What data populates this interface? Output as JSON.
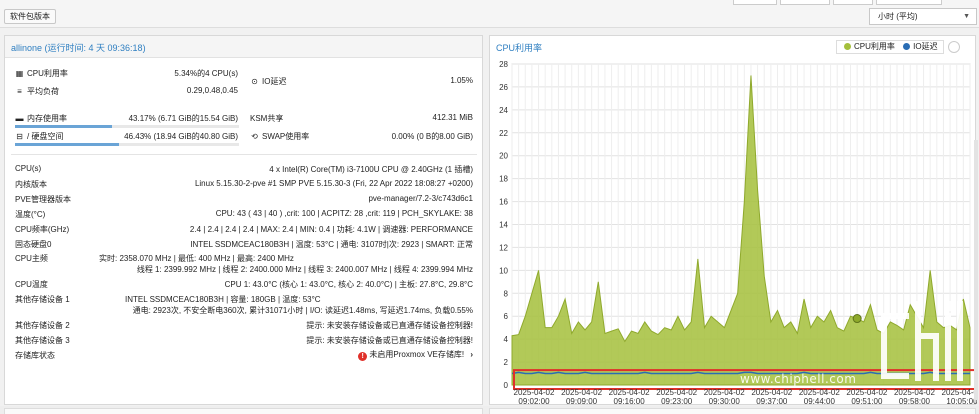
{
  "toolbar": {
    "package_button": "软件包版本",
    "timeframe": "小时 (平均)"
  },
  "node": {
    "title": "allinone (运行时间: 4 天 09:36:18)",
    "summary": {
      "cpu_label": "CPU利用率",
      "cpu_value": "5.34%的4 CPU(s)",
      "io_label": "IO延迟",
      "io_value": "1.05%",
      "load_label": "平均负荷",
      "load_value": "0.29,0.48,0.45",
      "mem_label": "内存使用率",
      "mem_value": "43.17% (6.71 GiB的15.54 GiB)",
      "mem_fraction": 0.4317,
      "ksm_label": "KSM共享",
      "ksm_value": "412.31 MiB",
      "disk_label": "/ 硬盘空间",
      "disk_value": "46.43% (18.94 GiB的40.80 GiB)",
      "disk_fraction": 0.4643,
      "swap_label": "SWAP使用率",
      "swap_value": "0.00% (0 B的8.00 GiB)"
    },
    "details": [
      {
        "label": "CPU(s)",
        "value": "4 x Intel(R) Core(TM) i3-7100U CPU @ 2.40GHz (1 插槽)"
      },
      {
        "label": "内核版本",
        "value": "Linux 5.15.30-2-pve #1 SMP PVE 5.15.30-3 (Fri, 22 Apr 2022 18:08:27 +0200)"
      },
      {
        "label": "PVE管理器版本",
        "value": "pve-manager/7.2-3/c743d6c1"
      },
      {
        "label": "温度(°C)",
        "value": "CPU: 43 ( 43 | 40 ) ,crit: 100 | ACPITZ: 28 ,crit: 119 | PCH_SKYLAKE: 38"
      },
      {
        "label": "CPU频率(GHz)",
        "value": "2.4 | 2.4 | 2.4 | 2.4 | MAX: 2.4 | MIN: 0.4 | 功耗: 4.1W | 调速器: PERFORMANCE"
      },
      {
        "label": "固态硬盘0",
        "value": "INTEL SSDMCEAC180B3H | 温度: 53°C | 通电: 3107时|次: 2923 | SMART: 正常"
      }
    ],
    "cpu_freq": {
      "label": "CPU主频",
      "line1": "实时: 2358.070 MHz | 最低: 400 MHz | 最高: 2400 MHz",
      "line2": "线程 1: 2399.992 MHz | 线程 2: 2400.000 MHz | 线程 3: 2400.007 MHz | 线程 4: 2399.994 MHz"
    },
    "cpu_temp": {
      "label": "CPU温度",
      "value": "CPU 1: 43.0°C (核心 1: 43.0°C, 核心 2: 40.0°C) | 主板: 27.8°C, 29.8°C"
    },
    "storage1": {
      "label": "其他存储设备 1",
      "line1": "INTEL SSDMCEAC180B3H | 容量: 180GB | 温度: 53°C",
      "line2": "通电: 2923次, 不安全断电360次, 累计31071小时 | I/O: 读延迟1.48ms, 写延迟1.74ms, 负载0.55%"
    },
    "storage2": {
      "label": "其他存储设备 2",
      "value": "提示: 未安装存储设备或已直通存储设备控制器!"
    },
    "storage3": {
      "label": "其他存储设备 3",
      "value": "提示: 未安装存储设备或已直通存储设备控制器!"
    },
    "repo": {
      "label": "存储库状态",
      "value": "未启用Proxmox VE存储库!"
    }
  },
  "chart_data": {
    "type": "area",
    "title": "CPU利用率",
    "legend": [
      "CPU利用率",
      "IO延迟"
    ],
    "legend_position": "top-right",
    "colors": {
      "cpu": "#a4bf3b",
      "io": "#2a6db4"
    },
    "ylim": [
      0,
      28
    ],
    "yticks": [
      0,
      2,
      4,
      6,
      8,
      10,
      12,
      14,
      16,
      18,
      20,
      22,
      24,
      26,
      28
    ],
    "xticks": [
      {
        "date": "2025-04-02",
        "time": "09:02:00"
      },
      {
        "date": "2025-04-02",
        "time": "09:09:00"
      },
      {
        "date": "2025-04-02",
        "time": "09:16:00"
      },
      {
        "date": "2025-04-02",
        "time": "09:23:00"
      },
      {
        "date": "2025-04-02",
        "time": "09:30:00"
      },
      {
        "date": "2025-04-02",
        "time": "09:37:00"
      },
      {
        "date": "2025-04-02",
        "time": "09:44:00"
      },
      {
        "date": "2025-04-02",
        "time": "09:51:00"
      },
      {
        "date": "2025-04-02",
        "time": "09:58:00"
      },
      {
        "date": "2025-04-02",
        "time": "10:05:00"
      }
    ],
    "grid": true,
    "cpu_values": [
      4.3,
      4.4,
      6,
      8,
      10,
      5,
      5,
      6,
      7.5,
      4.5,
      5.5,
      4.8,
      5.5,
      9,
      4.5,
      4.7,
      4.9,
      3.8,
      4.7,
      4.5,
      5.5,
      4.7,
      4.4,
      5,
      4.8,
      6,
      4.8,
      5.5,
      11,
      5,
      6,
      5.5,
      5,
      6.5,
      8,
      16,
      27,
      17,
      9.5,
      5.5,
      6.5,
      5,
      5.5,
      4.5,
      7.5,
      5,
      6,
      5.5,
      6.5,
      5,
      4.7,
      6,
      5.8,
      5.5,
      7,
      4.8,
      4.5,
      5.5,
      5.2,
      4.8,
      7,
      6,
      5,
      10,
      5.5,
      5,
      5.2,
      4.8,
      7.5,
      5
    ],
    "highlight_index": 52,
    "io_values": [
      1,
      1.1,
      1,
      1,
      1.1,
      1,
      1,
      1.1,
      1,
      1,
      1,
      1.1,
      1,
      1,
      1,
      1,
      1,
      1,
      1,
      1,
      1.1,
      1,
      1,
      1,
      1,
      1,
      1,
      1,
      1.1,
      1,
      1,
      1,
      1,
      1,
      1,
      1.1,
      1.1,
      1,
      1,
      1,
      1,
      1,
      1,
      1,
      1.1,
      1,
      1,
      1,
      1,
      1,
      1,
      1,
      1,
      1,
      1.1,
      1,
      1,
      1,
      1,
      1,
      1,
      1,
      1,
      1.1,
      1,
      1,
      1,
      1,
      1,
      1
    ]
  },
  "watermark": "www.chiphell.com"
}
